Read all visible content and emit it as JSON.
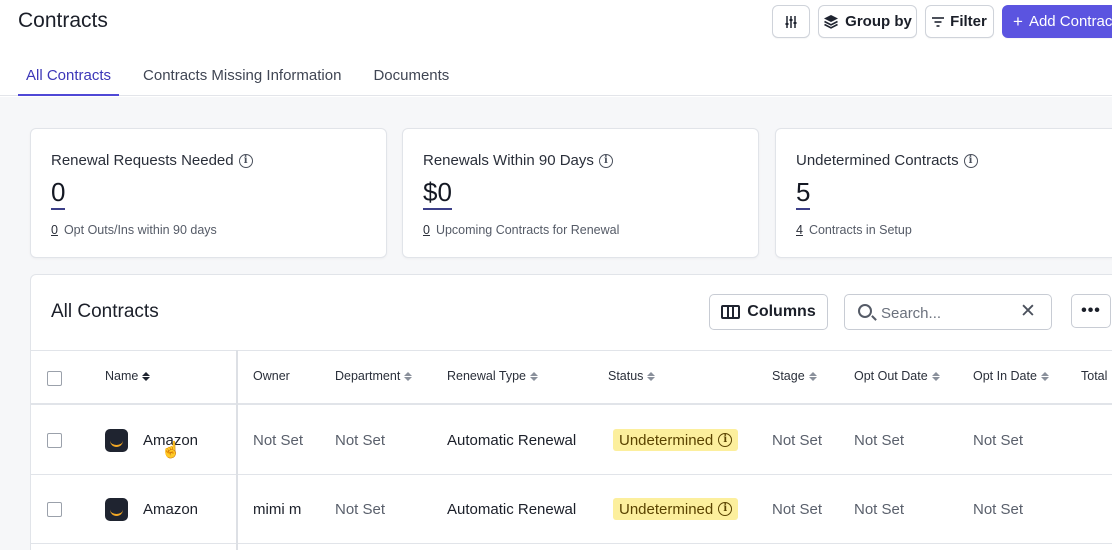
{
  "header": {
    "title": "Contracts",
    "group_by_label": "Group by",
    "filter_label": "Filter",
    "add_label": "Add Contract"
  },
  "tabs": [
    {
      "label": "All Contracts",
      "active": true
    },
    {
      "label": "Contracts Missing Information",
      "active": false
    },
    {
      "label": "Documents",
      "active": false
    }
  ],
  "cards": [
    {
      "title": "Renewal Requests Needed",
      "value": "0",
      "sub_num": "0",
      "sub_text": "Opt Outs/Ins within 90 days"
    },
    {
      "title": "Renewals Within 90 Days",
      "value": "$0",
      "sub_num": "0",
      "sub_text": "Upcoming Contracts for Renewal"
    },
    {
      "title": "Undetermined Contracts",
      "value": "5",
      "sub_num": "4",
      "sub_text": "Contracts in Setup"
    }
  ],
  "table": {
    "title": "All Contracts",
    "columns_label": "Columns",
    "search_placeholder": "Search...",
    "headers": [
      "Name",
      "Owner",
      "Department",
      "Renewal Type",
      "Status",
      "Stage",
      "Opt Out Date",
      "Opt In Date",
      "Total"
    ],
    "rows": [
      {
        "name": "Amazon",
        "owner": "Not Set",
        "department": "Not Set",
        "renewal_type": "Automatic Renewal",
        "status": "Undetermined",
        "stage": "Not Set",
        "opt_out_date": "Not Set",
        "opt_in_date": "Not Set"
      },
      {
        "name": "Amazon",
        "owner": "mimi m",
        "department": "Not Set",
        "renewal_type": "Automatic Renewal",
        "status": "Undetermined",
        "stage": "Not Set",
        "opt_out_date": "Not Set",
        "opt_in_date": "Not Set"
      }
    ]
  },
  "colors": {
    "accent": "#5b54e0",
    "status_undetermined_bg": "#fcef9d"
  },
  "icons": [
    "sliders-icon",
    "layers-icon",
    "filter-icon",
    "plus-icon",
    "info-icon",
    "columns-icon",
    "search-icon",
    "close-icon",
    "more-icon",
    "sort-icon",
    "amazon-logo-icon",
    "pointer-cursor-icon"
  ]
}
